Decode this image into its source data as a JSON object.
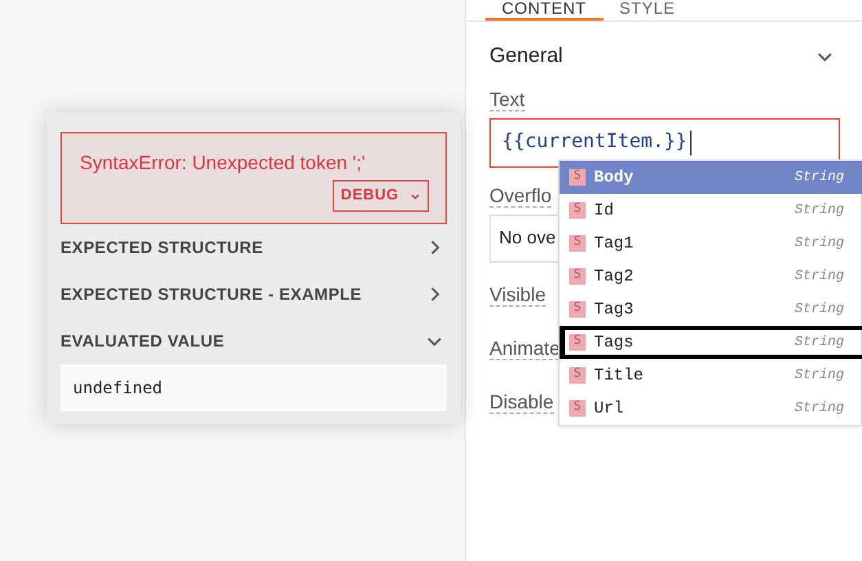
{
  "tabs": [
    {
      "label": "CONTENT",
      "selected": true
    },
    {
      "label": "STYLE",
      "selected": false
    }
  ],
  "section": {
    "title": "General",
    "expanded": true
  },
  "text_field": {
    "label": "Text",
    "value": "{{currentItem.}}"
  },
  "properties": [
    {
      "label": "Overflo",
      "value": "No ove"
    },
    {
      "label": "Visible"
    },
    {
      "label": "Animate"
    },
    {
      "label": "Disable"
    }
  ],
  "suggestions": [
    {
      "badge": "S",
      "name": "Body",
      "type": "String",
      "selected": true,
      "outlined": false
    },
    {
      "badge": "S",
      "name": "Id",
      "type": "String",
      "selected": false,
      "outlined": false
    },
    {
      "badge": "S",
      "name": "Tag1",
      "type": "String",
      "selected": false,
      "outlined": false
    },
    {
      "badge": "S",
      "name": "Tag2",
      "type": "String",
      "selected": false,
      "outlined": false
    },
    {
      "badge": "S",
      "name": "Tag3",
      "type": "String",
      "selected": false,
      "outlined": false
    },
    {
      "badge": "S",
      "name": "Tags",
      "type": "String",
      "selected": false,
      "outlined": true
    },
    {
      "badge": "S",
      "name": "Title",
      "type": "String",
      "selected": false,
      "outlined": false
    },
    {
      "badge": "S",
      "name": "Url",
      "type": "String",
      "selected": false,
      "outlined": false
    }
  ],
  "evaluation": {
    "error": "SyntaxError: Unexpected token ';'",
    "debug_label": "DEBUG",
    "sections": [
      {
        "title": "EXPECTED STRUCTURE",
        "expanded": false
      },
      {
        "title": "EXPECTED STRUCTURE - EXAMPLE",
        "expanded": false
      },
      {
        "title": "EVALUATED VALUE",
        "expanded": true
      }
    ],
    "value": "undefined"
  }
}
